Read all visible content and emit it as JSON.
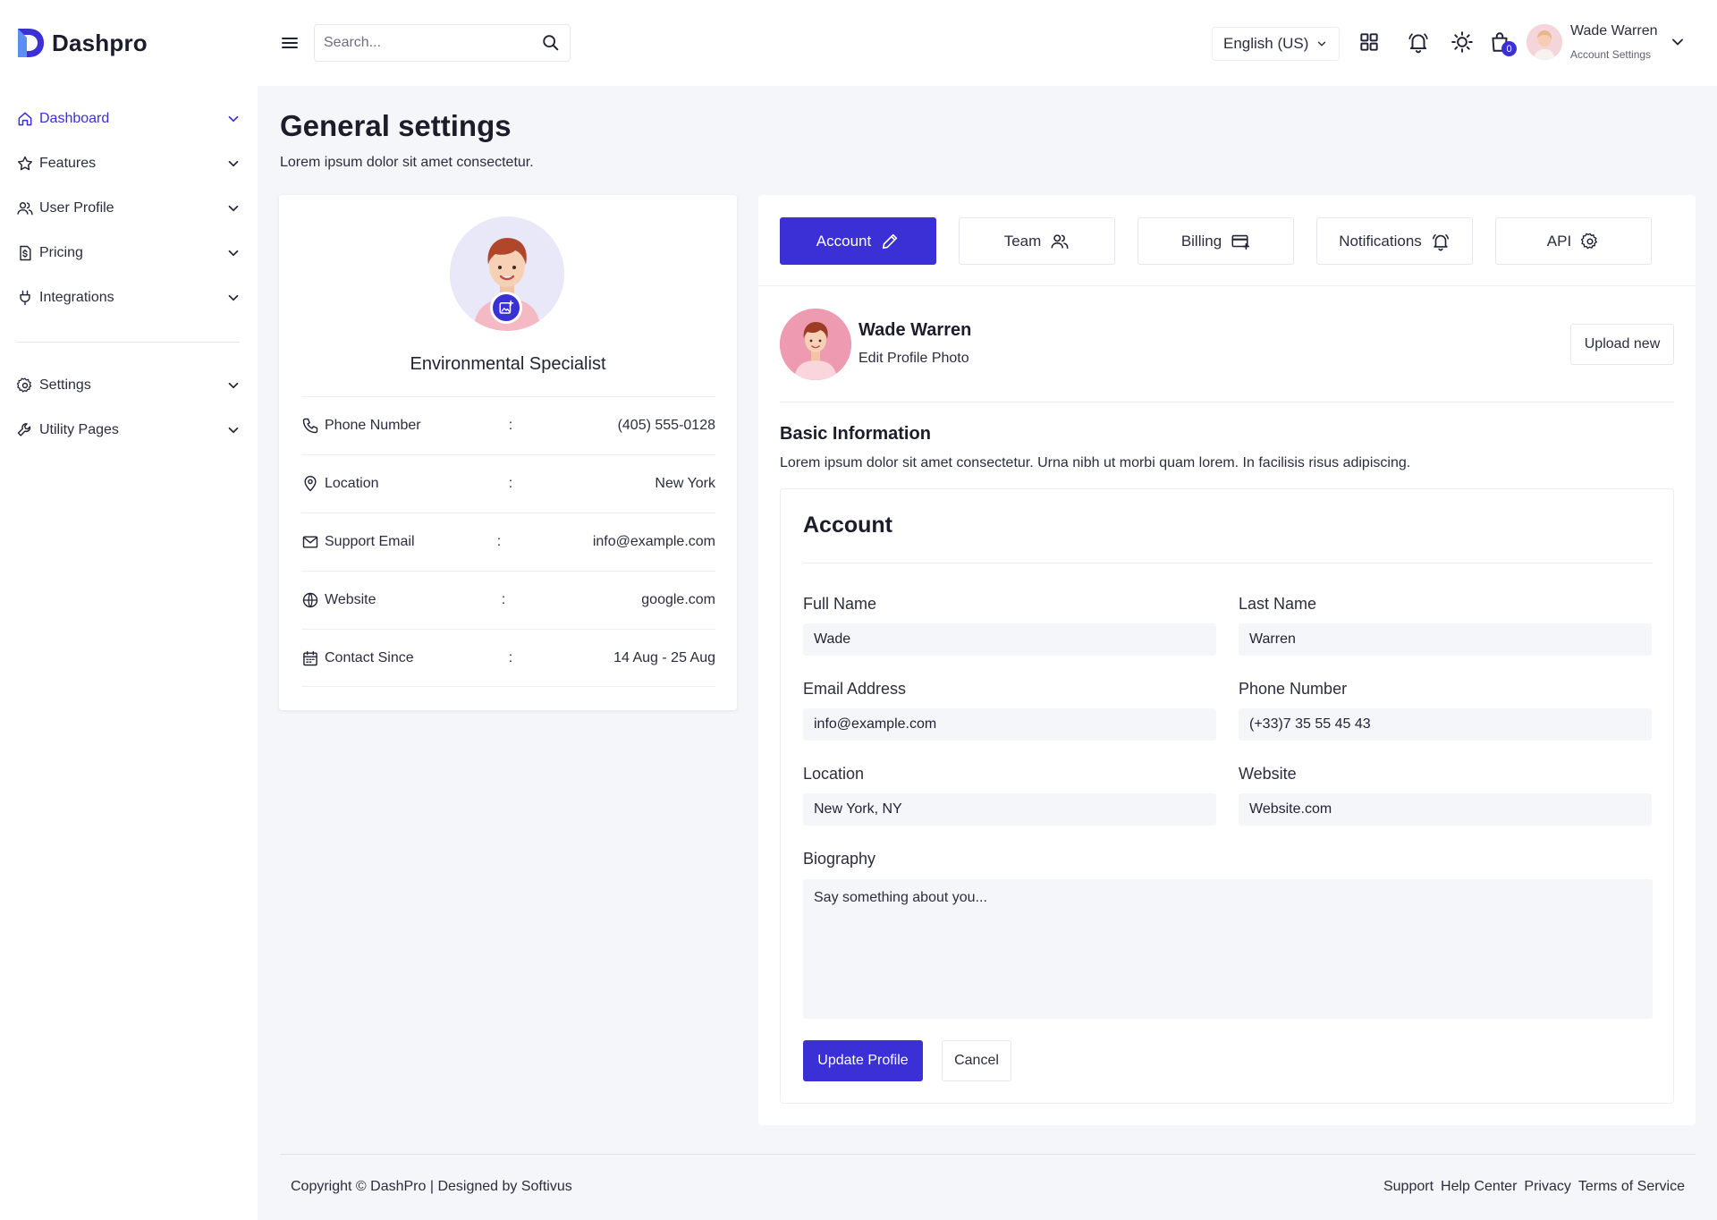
{
  "brand": {
    "name": "Dashpro",
    "accent": "#3b2fd6"
  },
  "header": {
    "search_placeholder": "Search...",
    "language": "English (US)",
    "cart_count": "0",
    "user": {
      "name": "Wade Warren",
      "subtitle": "Account Settings"
    }
  },
  "sidebar": {
    "items": [
      {
        "label": "Dashboard",
        "icon": "home-icon",
        "active": true
      },
      {
        "label": "Features",
        "icon": "star-icon"
      },
      {
        "label": "User Profile",
        "icon": "users-icon"
      },
      {
        "label": "Pricing",
        "icon": "dollar-document-icon"
      },
      {
        "label": "Integrations",
        "icon": "plug-icon"
      }
    ],
    "secondary": [
      {
        "label": "Settings",
        "icon": "gear-icon"
      },
      {
        "label": "Utility Pages",
        "icon": "wrench-icon"
      }
    ]
  },
  "page": {
    "title": "General settings",
    "subtitle": "Lorem ipsum dolor sit amet consectetur."
  },
  "profile_card": {
    "role": "Environmental Specialist",
    "rows": [
      {
        "label": "Phone Number",
        "value": "(405) 555-0128",
        "icon": "phone-icon"
      },
      {
        "label": "Location",
        "value": "New York",
        "icon": "location-pin-icon"
      },
      {
        "label": "Support Email",
        "value": "info@example.com",
        "icon": "mail-icon"
      },
      {
        "label": "Website",
        "value": "google.com",
        "icon": "globe-icon"
      },
      {
        "label": "Contact Since",
        "value": "14 Aug - 25 Aug",
        "icon": "calendar-icon"
      }
    ],
    "separator": ":"
  },
  "tabs": [
    {
      "label": "Account",
      "icon": "pencil-icon",
      "active": true
    },
    {
      "label": "Team",
      "icon": "users-icon"
    },
    {
      "label": "Billing",
      "icon": "credit-card-icon"
    },
    {
      "label": "Notifications",
      "icon": "bell-icon"
    },
    {
      "label": "API",
      "icon": "gear-icon"
    }
  ],
  "account_header": {
    "name": "Wade Warren",
    "edit_label": "Edit Profile Photo",
    "upload_label": "Upload new"
  },
  "basic_info": {
    "title": "Basic Information",
    "description": "Lorem ipsum dolor sit amet consectetur. Urna nibh ut morbi quam lorem. In facilisis risus adipiscing."
  },
  "form": {
    "title": "Account",
    "full_name": {
      "label": "Full Name",
      "value": "Wade"
    },
    "last_name": {
      "label": "Last Name",
      "value": "Warren"
    },
    "email": {
      "label": "Email Address",
      "value": "info@example.com"
    },
    "phone": {
      "label": "Phone Number",
      "value": "(+33)7 35 55 45 43"
    },
    "location": {
      "label": "Location",
      "value": "New York, NY"
    },
    "website": {
      "label": "Website",
      "value": "Website.com"
    },
    "biography": {
      "label": "Biography",
      "placeholder": "Say something about you..."
    },
    "submit_label": "Update Profile",
    "cancel_label": "Cancel"
  },
  "footer": {
    "copyright": "Copyright © DashPro | Designed by Softivus",
    "links": [
      "Support",
      "Help Center",
      "Privacy",
      "Terms of Service"
    ]
  }
}
